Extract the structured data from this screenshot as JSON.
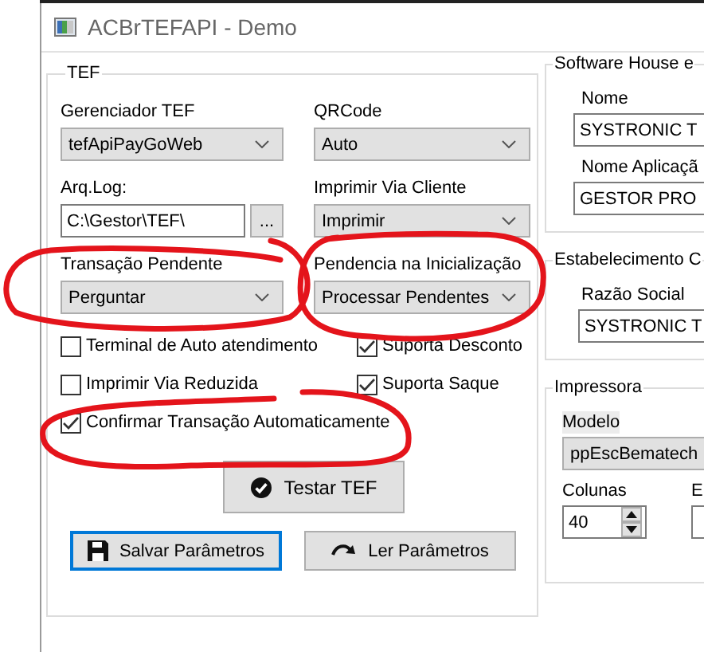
{
  "window": {
    "title": "ACBrTEFAPI - Demo"
  },
  "tef_group": {
    "title": "TEF",
    "fields": [
      {
        "label": "Gerenciador TEF",
        "kind": "select",
        "value": "tefApiPayGoWeb"
      },
      {
        "label": "QRCode",
        "kind": "select",
        "value": "Auto"
      },
      {
        "label": "Arq.Log:",
        "kind": "file",
        "value": "C:\\Gestor\\TEF\\",
        "button": "..."
      },
      {
        "label": "Imprimir Via Cliente",
        "kind": "select",
        "value": "Imprimir"
      },
      {
        "label": "Transação Pendente",
        "kind": "select",
        "value": "Perguntar"
      },
      {
        "label": "Pendencia na Inicialização",
        "kind": "select",
        "value": "Processar Pendentes"
      }
    ],
    "checkboxes": [
      {
        "label": "Terminal de Auto atendimento",
        "checked": false
      },
      {
        "label": "Suporta Desconto",
        "checked": true
      },
      {
        "label": "Imprimir Via Reduzida",
        "checked": false
      },
      {
        "label": "Suporta Saque",
        "checked": true
      },
      {
        "label": "Confirmar Transação Automaticamente",
        "checked": true
      }
    ],
    "test_button": "Testar TEF",
    "buttons": [
      {
        "label": "Salvar Parâmetros",
        "kind": "save",
        "focused": true
      },
      {
        "label": "Ler Parâmetros",
        "kind": "redo",
        "focused": false
      }
    ]
  },
  "software_house": {
    "title": "Software House e",
    "fields": [
      {
        "label": "Nome",
        "value": "SYSTRONIC T"
      },
      {
        "label": "Nome Aplicaçã",
        "value": "GESTOR PRO"
      }
    ]
  },
  "estabelecimento": {
    "title": "Estabelecimento C",
    "fields": [
      {
        "label": "Razão Social",
        "value": "SYSTRONIC T"
      }
    ]
  },
  "impressora": {
    "title": "Impressora",
    "modelo": {
      "label": "Modelo",
      "value": "ppEscBematech"
    },
    "colunas": {
      "label": "Colunas",
      "value": "40"
    },
    "column_3_label": "E"
  }
}
